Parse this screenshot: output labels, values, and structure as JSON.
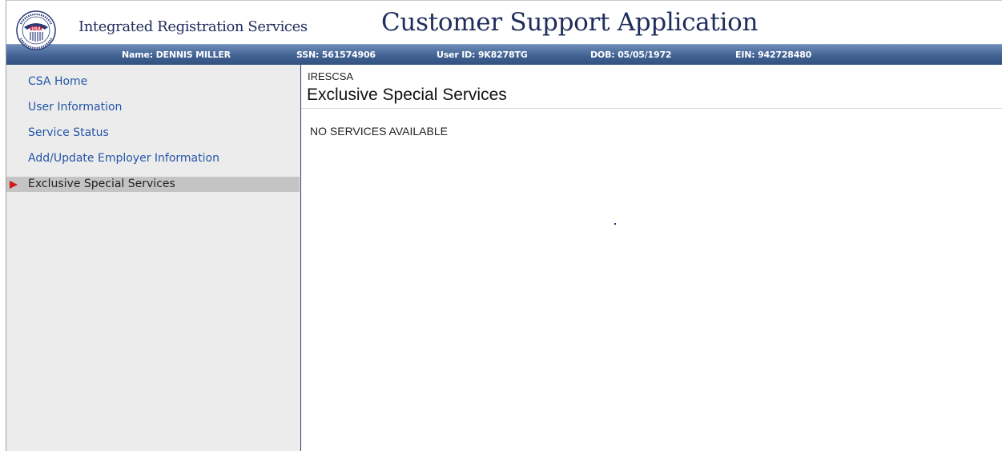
{
  "header": {
    "brand_name": "Integrated Registration Services",
    "app_title": "Customer Support Application",
    "seal_text": "SOCIAL SECURITY ADMINISTRATION USA"
  },
  "info_bar": {
    "name": "Name: DENNIS MILLER",
    "ssn": "SSN: 561574906",
    "user_id": "User ID: 9K8278TG",
    "dob": "DOB: 05/05/1972",
    "ein": "EIN: 942728480"
  },
  "sidebar": {
    "items": [
      {
        "label": "CSA Home"
      },
      {
        "label": "User Information"
      },
      {
        "label": "Service Status"
      },
      {
        "label": "Add/Update Employer Information"
      },
      {
        "label": "Exclusive Special Services"
      }
    ]
  },
  "main": {
    "app_code": "IRESCSA",
    "title": "Exclusive Special Services",
    "message": "NO SERVICES AVAILABLE"
  },
  "colors": {
    "bar": "#3e5f91",
    "link": "#2556a8",
    "active_arrow": "#d11a1a",
    "title": "#1f2d5c"
  }
}
